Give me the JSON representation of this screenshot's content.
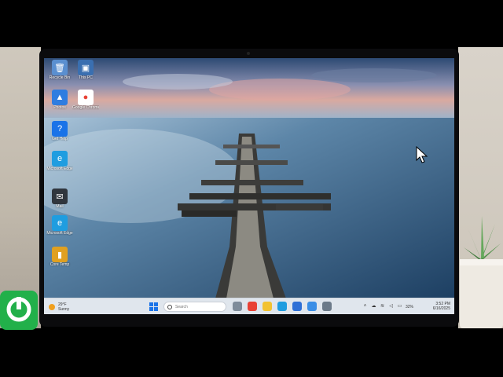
{
  "desktop_icons": [
    {
      "name": "recycle-bin",
      "label": "Recycle Bin",
      "color": "#5a8fd0",
      "glyph": "🗑"
    },
    {
      "name": "this-pc",
      "label": "This PC",
      "color": "#3a6fb0",
      "glyph": "▣"
    },
    {
      "name": "photos",
      "label": "Photos",
      "color": "#2f7de0",
      "glyph": "▲"
    },
    {
      "name": "google-chrome",
      "label": "Google Chrome",
      "color": "#ffffff",
      "glyph": "●"
    },
    {
      "name": "get-help",
      "label": "Get Help",
      "color": "#1a73e8",
      "glyph": "?"
    },
    {
      "name": "microsoft-edge",
      "label": "Microsoft Edge",
      "color": "#1f9de0",
      "glyph": "e"
    },
    {
      "name": "mail",
      "label": "Mail",
      "color": "#30363e",
      "glyph": "✉"
    },
    {
      "name": "microsoft-edge-2",
      "label": "Microsoft Edge",
      "color": "#1f9de0",
      "glyph": "e"
    },
    {
      "name": "core-temp",
      "label": "Core Temp",
      "color": "#e0a020",
      "glyph": "▮"
    }
  ],
  "taskbar": {
    "weather_temp": "29°F",
    "weather_desc": "Sunny",
    "search_placeholder": "Search",
    "apps": [
      {
        "name": "task-view",
        "color": "#7f8c9a"
      },
      {
        "name": "chrome",
        "color": "#e94235"
      },
      {
        "name": "file-explorer",
        "color": "#f2c230"
      },
      {
        "name": "edge",
        "color": "#1f9de0"
      },
      {
        "name": "store",
        "color": "#2d6fd6"
      },
      {
        "name": "photos",
        "color": "#3a8ee6"
      },
      {
        "name": "settings",
        "color": "#6c7a89"
      }
    ],
    "battery_percent": "32%",
    "time": "3:52 PM",
    "date": "6/16/2025"
  },
  "colors": {
    "accent": "#1a73e8",
    "taskbar_bg": "#e8ecf2",
    "sky_top": "#3d5c85",
    "water": "#2c5270"
  }
}
